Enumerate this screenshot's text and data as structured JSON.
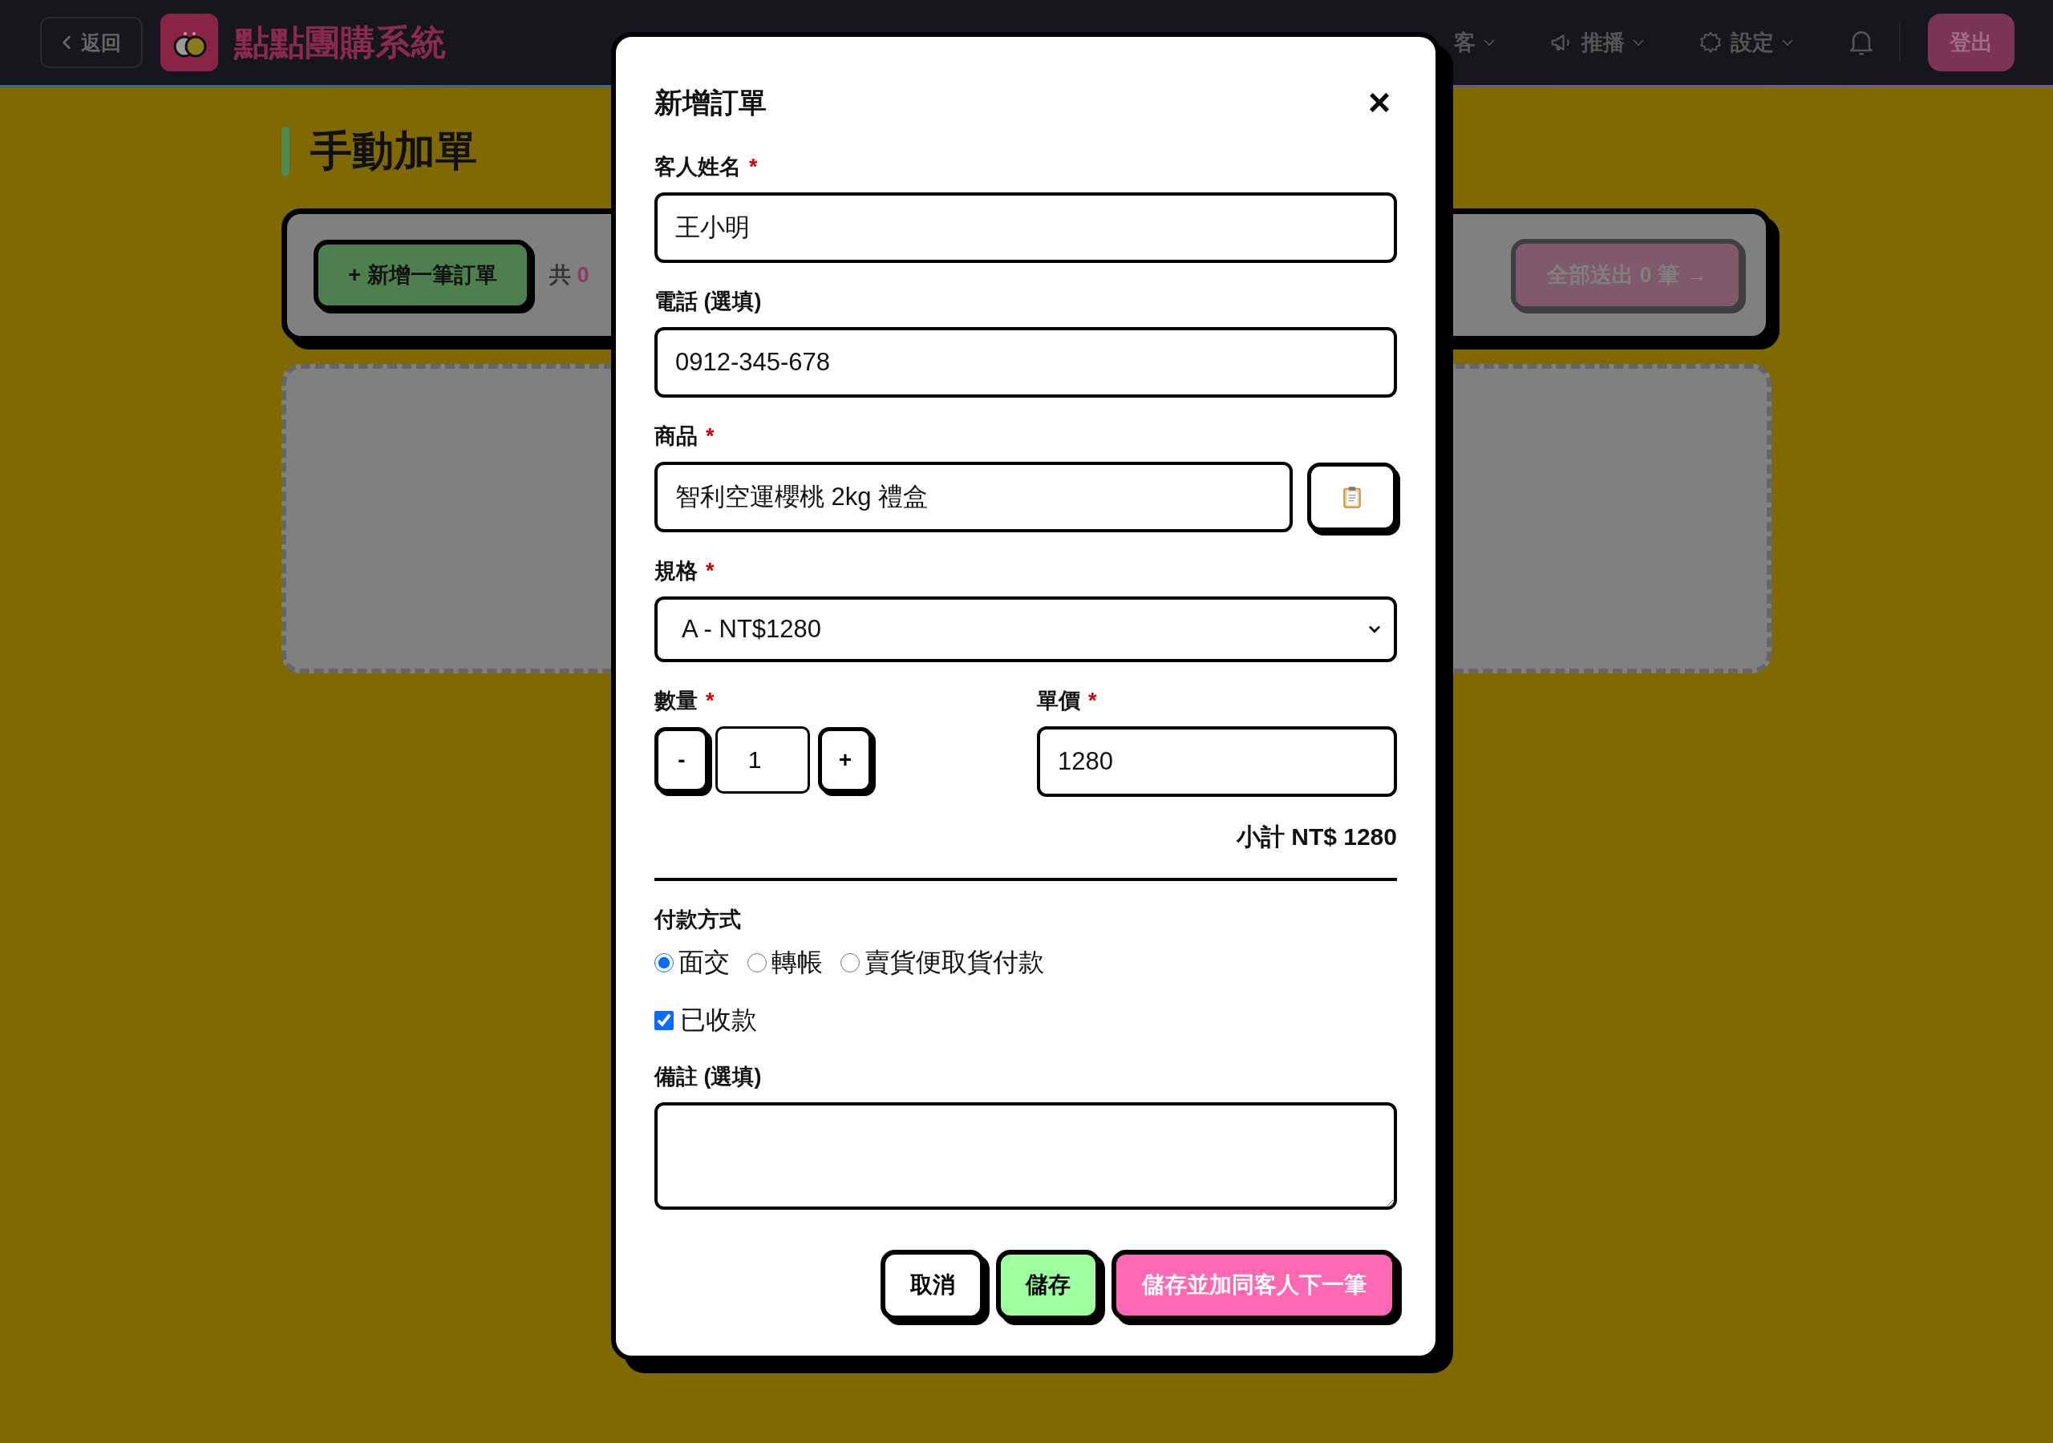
{
  "topbar": {
    "back": "返回",
    "app_title": "點點團購系統",
    "nav": [
      {
        "label": "客",
        "kind": "plain"
      },
      {
        "label": "推播",
        "kind": "megaphone"
      },
      {
        "label": "設定",
        "kind": "gear"
      }
    ],
    "logout": "登出"
  },
  "page": {
    "title": "手動加單",
    "add_button": "+ 新增一筆訂單",
    "count_label": "共",
    "count_value": "0",
    "submit_all": "全部送出 0 筆 →"
  },
  "modal": {
    "title": "新增訂單",
    "close": "×",
    "fields": [
      {
        "kind": "text",
        "label": "客人姓名",
        "required_mark": "*",
        "value": "王小明"
      },
      {
        "kind": "text",
        "label": "電話 (選填)",
        "value": "0912-345-678"
      },
      {
        "kind": "text_with_button",
        "label": "商品",
        "required_mark": "*",
        "value": "智利空運櫻桃 2kg 禮盒"
      },
      {
        "kind": "select",
        "label": "規格",
        "required_mark": "*",
        "value": "A - NT$1280"
      }
    ],
    "quantity": {
      "label": "數量",
      "required_mark": "*",
      "minus": "-",
      "value": "1",
      "plus": "+"
    },
    "unit_price": {
      "label": "單價",
      "required_mark": "*",
      "value": "1280"
    },
    "subtotal": "小計 NT$ 1280",
    "payment": {
      "label": "付款方式",
      "options": [
        {
          "label": "面交",
          "selected": true
        },
        {
          "label": "轉帳",
          "selected": false
        },
        {
          "label": "賣貨便取貨付款",
          "selected": false
        }
      ]
    },
    "paid": {
      "label": "已收款",
      "checked": true
    },
    "notes": {
      "label": "備註 (選填)"
    },
    "buttons": [
      {
        "label": "取消",
        "kind": "cancel"
      },
      {
        "label": "儲存",
        "kind": "save"
      },
      {
        "label": "儲存並加同客人下一筆",
        "kind": "save_next"
      }
    ]
  }
}
